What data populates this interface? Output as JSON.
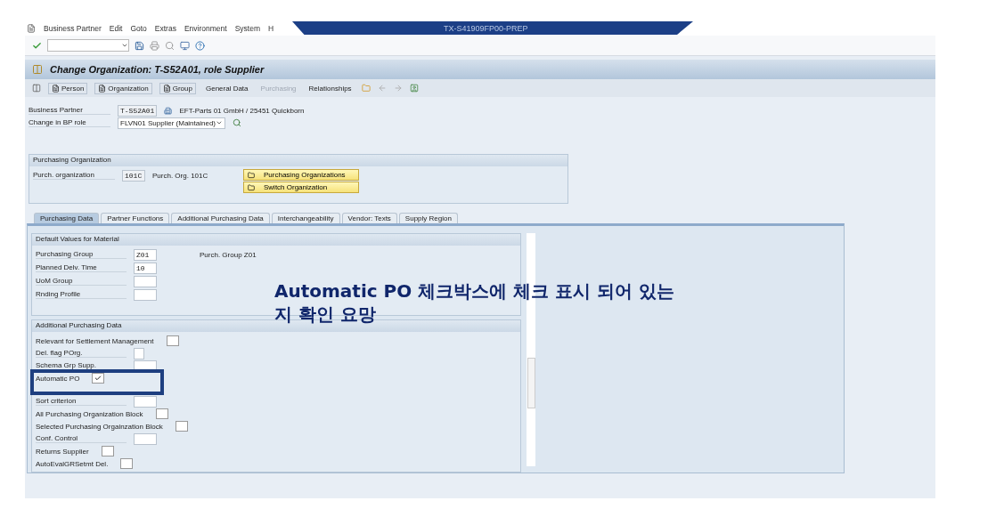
{
  "window": {
    "title": "TX-S41909FP00-PREP"
  },
  "menu": [
    "Business Partner",
    "Edit",
    "Goto",
    "Extras",
    "Environment",
    "System",
    "H"
  ],
  "screen_title": "Change Organization: T-S52A01, role Supplier",
  "app_toolbar": [
    {
      "label": "Person",
      "kind": "doc",
      "disabled": false
    },
    {
      "label": "Organization",
      "kind": "doc",
      "disabled": false
    },
    {
      "label": "Group",
      "kind": "doc",
      "disabled": false
    },
    {
      "label": "General Data",
      "kind": "text",
      "disabled": false
    },
    {
      "label": "Purchasing",
      "kind": "text",
      "disabled": true
    },
    {
      "label": "Relationships",
      "kind": "text",
      "disabled": false
    }
  ],
  "header": {
    "bp_label": "Business Partner",
    "bp_value": "T-S52A01",
    "bp_name": "EFT-Parts 01 GmbH / 25451 Quickborn",
    "role_label": "Change in BP role",
    "role_value": "FLVN01 Supplier (Maintained)"
  },
  "purch_org": {
    "title": "Purchasing Organization",
    "label": "Purch. organization",
    "value": "101C",
    "description": "Purch. Org. 101C",
    "buttons": [
      "Purchasing Organizations",
      "Switch Organization"
    ]
  },
  "tabs": [
    {
      "label": "Purchasing Data",
      "selected": true
    },
    {
      "label": "Partner Functions",
      "selected": false
    },
    {
      "label": "Additional Purchasing Data",
      "selected": false
    },
    {
      "label": "Interchangeability",
      "selected": false
    },
    {
      "label": "Vendor: Texts",
      "selected": false
    },
    {
      "label": "Supply Region",
      "selected": false
    }
  ],
  "sections": [
    {
      "title": "Default Values for Material",
      "rows": [
        {
          "label": "Purchasing Group",
          "kind": "field",
          "value": "Z01",
          "description": "Purch. Group Z01"
        },
        {
          "label": "Planned Delv. Time",
          "kind": "field",
          "value": "10"
        },
        {
          "label": "UoM Group",
          "kind": "field"
        },
        {
          "label": "Rnding Profile",
          "kind": "field"
        }
      ]
    },
    {
      "title": "Additional Purchasing Data",
      "rows": [
        {
          "label": "Relevant for Settlement Management",
          "kind": "checkbox",
          "checked": false
        },
        {
          "label": "Del. flag POrg.",
          "kind": "flag"
        },
        {
          "label": "Schema Grp Supp.",
          "kind": "field"
        },
        {
          "label": "Automatic PO",
          "kind": "checkbox",
          "checked": true,
          "highlighted": true
        },
        {
          "label": "Sort criterion",
          "kind": "field"
        },
        {
          "label": "All Purchasing Organization Block",
          "kind": "checkbox",
          "checked": false
        },
        {
          "label": "Selected Purchasing Orgainzation Block",
          "kind": "checkbox",
          "checked": false
        },
        {
          "label": "Conf. Control",
          "kind": "field"
        },
        {
          "label": "Returns Supplier",
          "kind": "checkbox",
          "checked": false
        },
        {
          "label": "AutoEvalGRSetmt Del.",
          "kind": "checkbox",
          "checked": false
        }
      ]
    }
  ],
  "annotation": {
    "lines": [
      "Automatic PO 체크박스에 체크 표시 되어 있는",
      "지 확인 요망"
    ]
  }
}
